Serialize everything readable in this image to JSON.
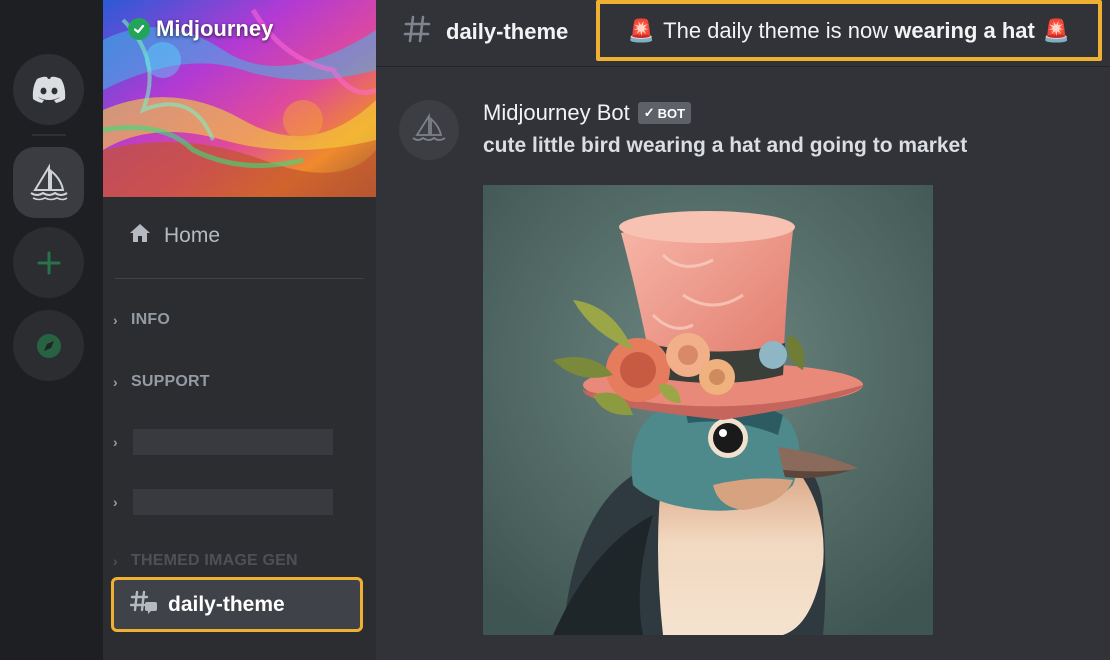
{
  "app": {
    "name": "Discord"
  },
  "server": {
    "name": "Midjourney",
    "verified": true,
    "accent": "#f0b132"
  },
  "rail": {
    "icons": [
      "discord-logo-icon",
      "midjourney-server-icon",
      "add-server-icon",
      "explore-servers-icon"
    ]
  },
  "sidebar": {
    "home_label": "Home",
    "categories": [
      {
        "label": "INFO"
      },
      {
        "label": "SUPPORT"
      },
      {
        "label": ""
      },
      {
        "label": ""
      },
      {
        "label": "THEMED IMAGE GEN"
      }
    ],
    "active_channel": "daily-theme"
  },
  "header": {
    "channel": "daily-theme",
    "topic_prefix": "The daily theme is now",
    "topic_emphasis": "wearing a hat",
    "topic_emoji": "🚨"
  },
  "message": {
    "author": "Midjourney Bot",
    "bot_tag": "BOT",
    "text": "cute little bird wearing a hat and going to market"
  }
}
